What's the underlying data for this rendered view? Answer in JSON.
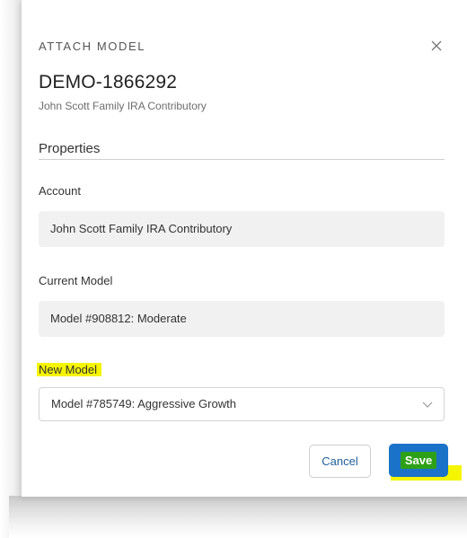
{
  "modal": {
    "label": "ATTACH MODEL",
    "code": "DEMO-1866292",
    "subtitle": "John Scott Family IRA Contributory",
    "section_title": "Properties"
  },
  "fields": {
    "account": {
      "label": "Account",
      "value": "John Scott Family IRA Contributory"
    },
    "current_model": {
      "label": "Current Model",
      "value": "Model #908812: Moderate"
    },
    "new_model": {
      "label": "New Model",
      "selected": "Model #785749: Aggressive Growth"
    }
  },
  "buttons": {
    "cancel": "Cancel",
    "save": "Save"
  },
  "icons": {
    "close": "close-icon",
    "dropdown": "chevron-down-icon"
  },
  "colors": {
    "primary": "#1b73c9",
    "highlight": "#f6f500",
    "save_highlight": "#2ea018"
  }
}
